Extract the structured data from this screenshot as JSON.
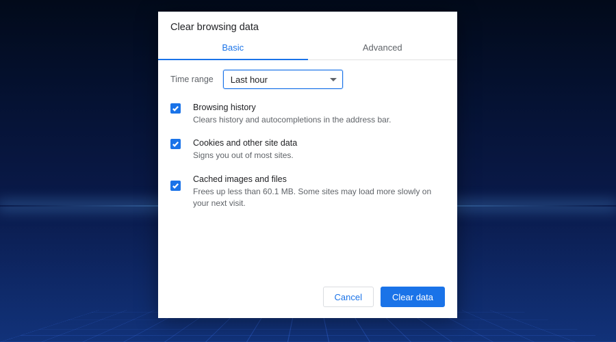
{
  "dialog": {
    "title": "Clear browsing data",
    "tabs": {
      "basic": "Basic",
      "advanced": "Advanced"
    },
    "time_range": {
      "label": "Time range",
      "selected": "Last hour"
    },
    "items": [
      {
        "title": "Browsing history",
        "description": "Clears history and autocompletions in the address bar."
      },
      {
        "title": "Cookies and other site data",
        "description": "Signs you out of most sites."
      },
      {
        "title": "Cached images and files",
        "description": "Frees up less than 60.1 MB. Some sites may load more slowly on your next visit."
      }
    ],
    "actions": {
      "cancel": "Cancel",
      "confirm": "Clear data"
    }
  }
}
